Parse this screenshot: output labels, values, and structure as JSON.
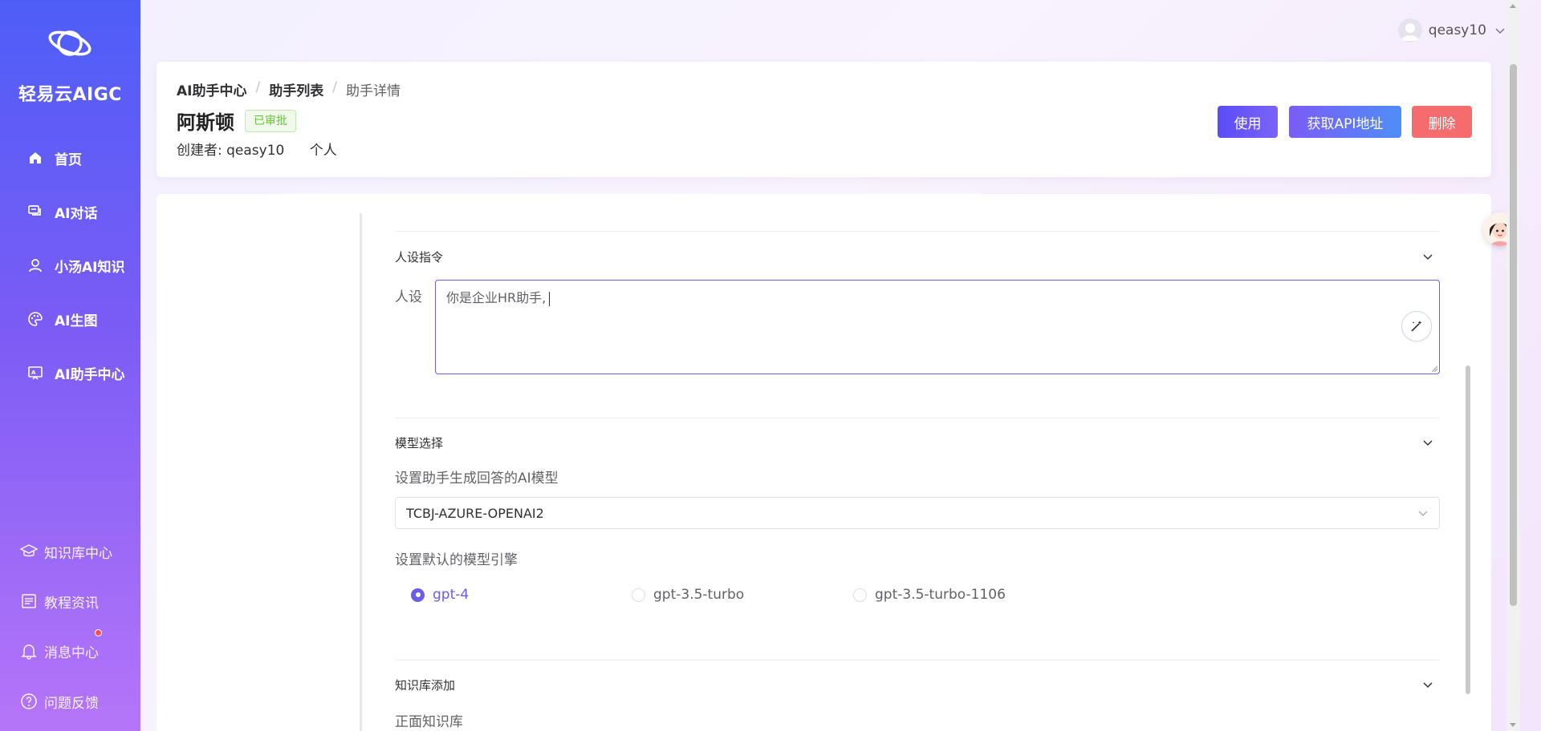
{
  "brand": {
    "name": "轻易云AIGC"
  },
  "sidebar": {
    "items": [
      {
        "label": "首页",
        "icon": "home-icon"
      },
      {
        "label": "AI对话",
        "icon": "chat-icon"
      },
      {
        "label": "小汤AI知识",
        "icon": "user-icon"
      },
      {
        "label": "AI生图",
        "icon": "palette-icon"
      },
      {
        "label": "AI助手中心",
        "icon": "assistant-icon"
      }
    ],
    "bottom_items": [
      {
        "label": "知识库中心",
        "icon": "graduation-cap-icon"
      },
      {
        "label": "教程资讯",
        "icon": "news-icon"
      },
      {
        "label": "消息中心",
        "icon": "bell-icon"
      },
      {
        "label": "问题反馈",
        "icon": "question-icon"
      }
    ]
  },
  "user": {
    "name": "qeasy10"
  },
  "breadcrumb": [
    "AI助手中心",
    "助手列表",
    "助手详情"
  ],
  "assistant": {
    "name": "阿斯顿",
    "status": "已审批",
    "creator_label": "创建者:",
    "creator": "qeasy10",
    "scope": "个人"
  },
  "actions": {
    "use": "使用",
    "get_api": "获取API地址",
    "delete": "删除"
  },
  "persona_section": {
    "title": "人设指令",
    "field_label": "人设",
    "value": "你是企业HR助手,"
  },
  "model_section": {
    "title": "模型选择",
    "model_label": "设置助手生成回答的AI模型",
    "selected_model": "TCBJ-AZURE-OPENAI2",
    "engine_label": "设置默认的模型引擎",
    "engines": [
      "gpt-4",
      "gpt-3.5-turbo",
      "gpt-3.5-turbo-1106"
    ],
    "selected_engine": "gpt-4"
  },
  "knowledge_section": {
    "title": "知识库添加",
    "positive_label": "正面知识库"
  },
  "colors": {
    "accent": "#6c5ce7",
    "danger": "#f56c6c",
    "success": "#67c23a"
  }
}
